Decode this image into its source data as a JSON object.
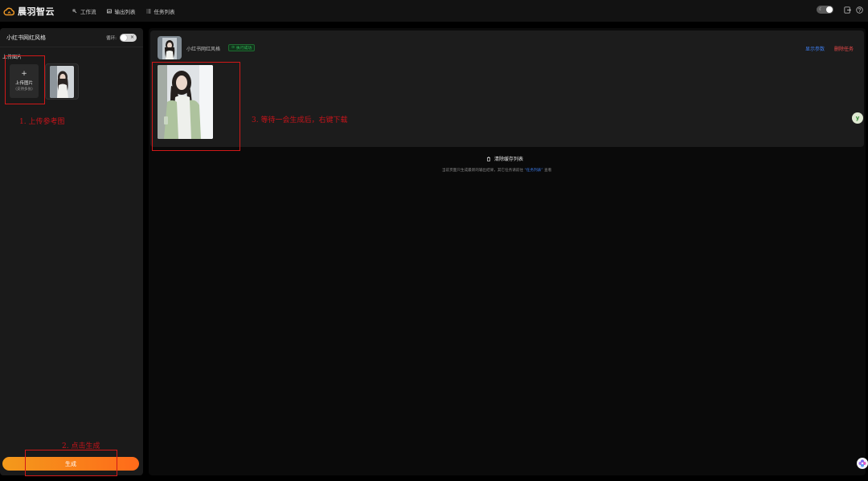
{
  "app": {
    "name": "晨羽智云"
  },
  "nav": [
    {
      "label": "工作流",
      "icon": "workflow-icon"
    },
    {
      "label": "输出列表",
      "icon": "image-list-icon"
    },
    {
      "label": "任务列表",
      "icon": "list-icon"
    }
  ],
  "left": {
    "title": "小红书网红风格",
    "loop_label": "循环:",
    "upload_section_label": "上传图片",
    "upload_box": {
      "title": "上传图片",
      "sub": "(支持多张)"
    },
    "generate_label": "生成"
  },
  "task": {
    "title": "小红书网红风格",
    "status": "执行成功",
    "show_params": "显示参数",
    "delete": "删除任务"
  },
  "clear_cache": "清除缓存列表",
  "hint": {
    "before": "当前页面只生成最新的输出结果，其它任务请前往 ",
    "link": "“任务列表”",
    "after": " 查看"
  },
  "annotations": {
    "step1": "1. 上传参考图",
    "step2": "2. 点击生成",
    "step3": "3. 等待一会生成后，右键下载"
  },
  "colors": {
    "accent_orange": "#ff7a1a",
    "link_blue": "#3d7ef0",
    "danger_red": "#f04a4a",
    "success_green": "#33c15c",
    "annotation_red": "#d01818"
  }
}
